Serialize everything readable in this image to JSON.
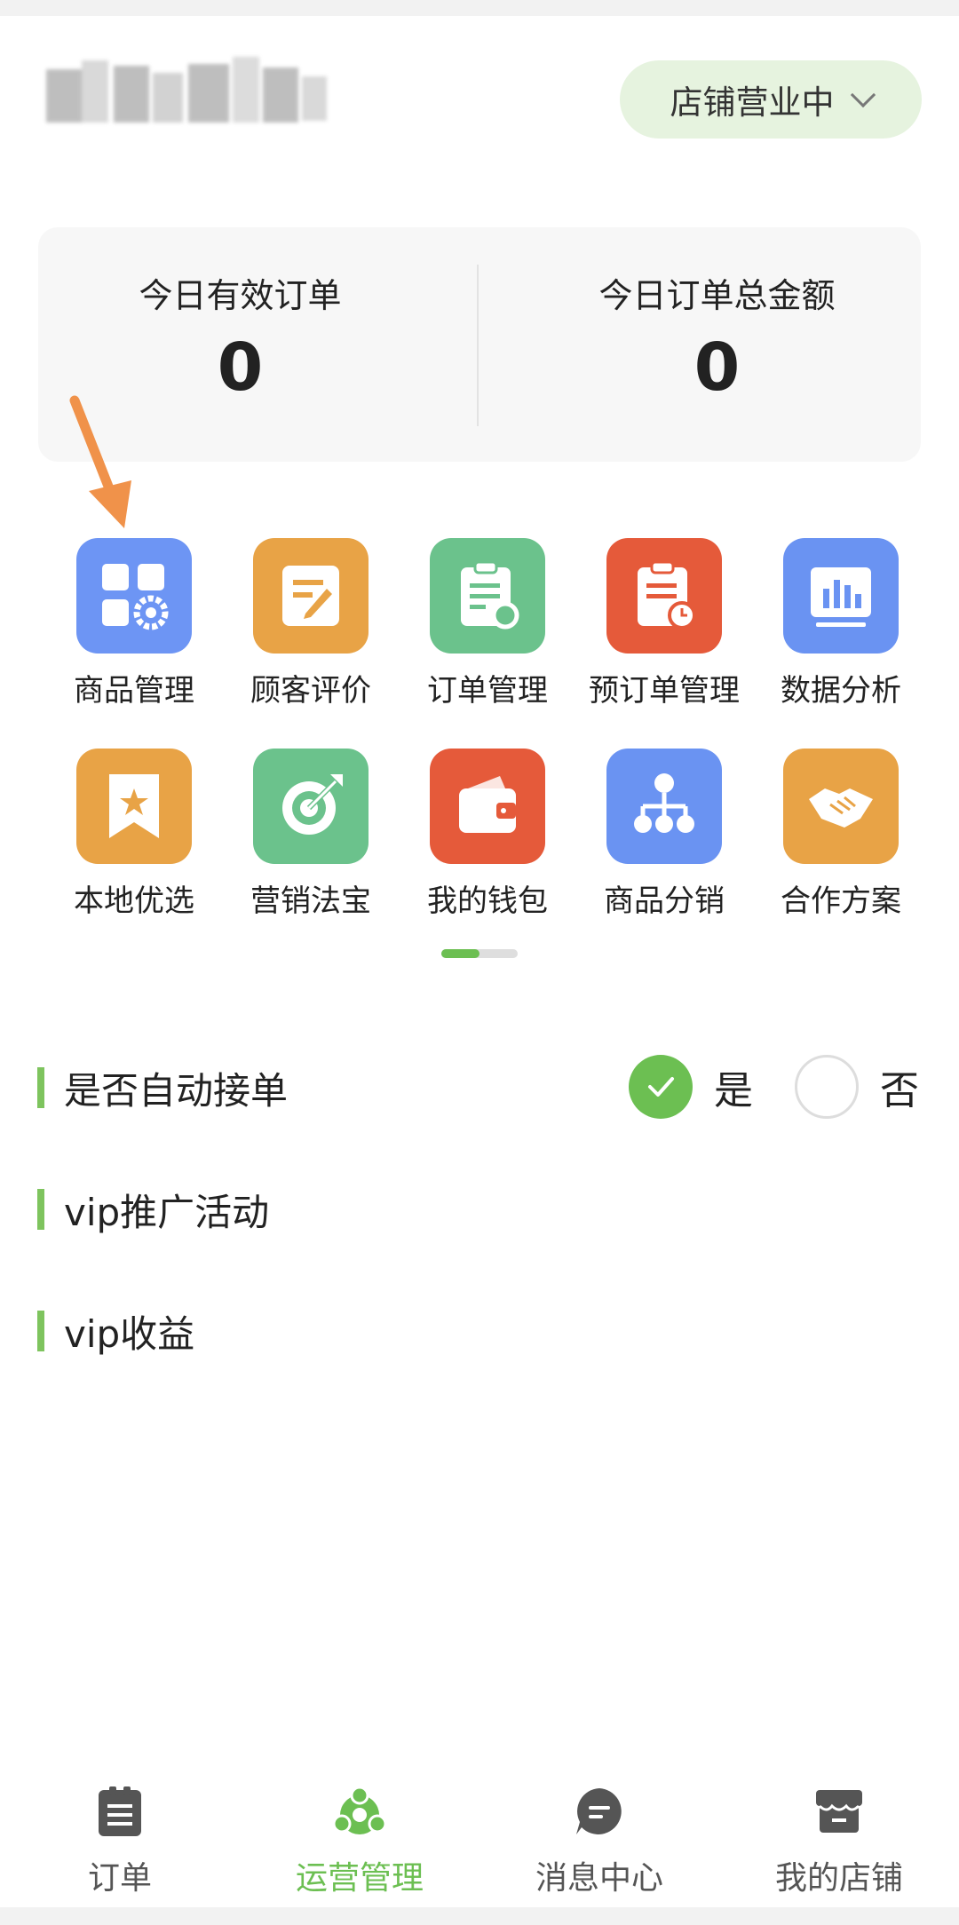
{
  "header": {
    "store_status": "店铺营业中"
  },
  "stats": {
    "valid_orders_label": "今日有效订单",
    "valid_orders_value": "0",
    "total_amount_label": "今日订单总金额",
    "total_amount_value": "0"
  },
  "grid": {
    "items": [
      {
        "label": "商品管理",
        "icon": "product-management-icon",
        "color": "#6d95f4"
      },
      {
        "label": "顾客评价",
        "icon": "customer-review-icon",
        "color": "#e8a346"
      },
      {
        "label": "订单管理",
        "icon": "order-management-icon",
        "color": "#6bc28c"
      },
      {
        "label": "预订单管理",
        "icon": "preorder-management-icon",
        "color": "#e55a3a"
      },
      {
        "label": "数据分析",
        "icon": "data-analysis-icon",
        "color": "#6a93f2"
      },
      {
        "label": "本地优选",
        "icon": "local-select-icon",
        "color": "#e8a346"
      },
      {
        "label": "营销法宝",
        "icon": "marketing-icon",
        "color": "#6bc28c"
      },
      {
        "label": "我的钱包",
        "icon": "wallet-icon",
        "color": "#e55a3a"
      },
      {
        "label": "商品分销",
        "icon": "distribution-icon",
        "color": "#6a93f2"
      },
      {
        "label": "合作方案",
        "icon": "cooperation-icon",
        "color": "#e8a346"
      }
    ],
    "page": 1,
    "pages": 2
  },
  "settings": {
    "auto_accept_label": "是否自动接单",
    "auto_accept_yes": "是",
    "auto_accept_no": "否",
    "auto_accept_value": "是",
    "vip_promo_label": "vip推广活动",
    "vip_income_label": "vip收益"
  },
  "tabbar": {
    "tabs": [
      {
        "label": "订单",
        "icon": "order-list-icon"
      },
      {
        "label": "运营管理",
        "icon": "operations-icon"
      },
      {
        "label": "消息中心",
        "icon": "message-icon"
      },
      {
        "label": "我的店铺",
        "icon": "store-icon"
      }
    ],
    "active": "运营管理"
  },
  "colors": {
    "accent": "#6cbf52",
    "status_bg": "#e6f3df",
    "arrow": "#f0924a"
  }
}
